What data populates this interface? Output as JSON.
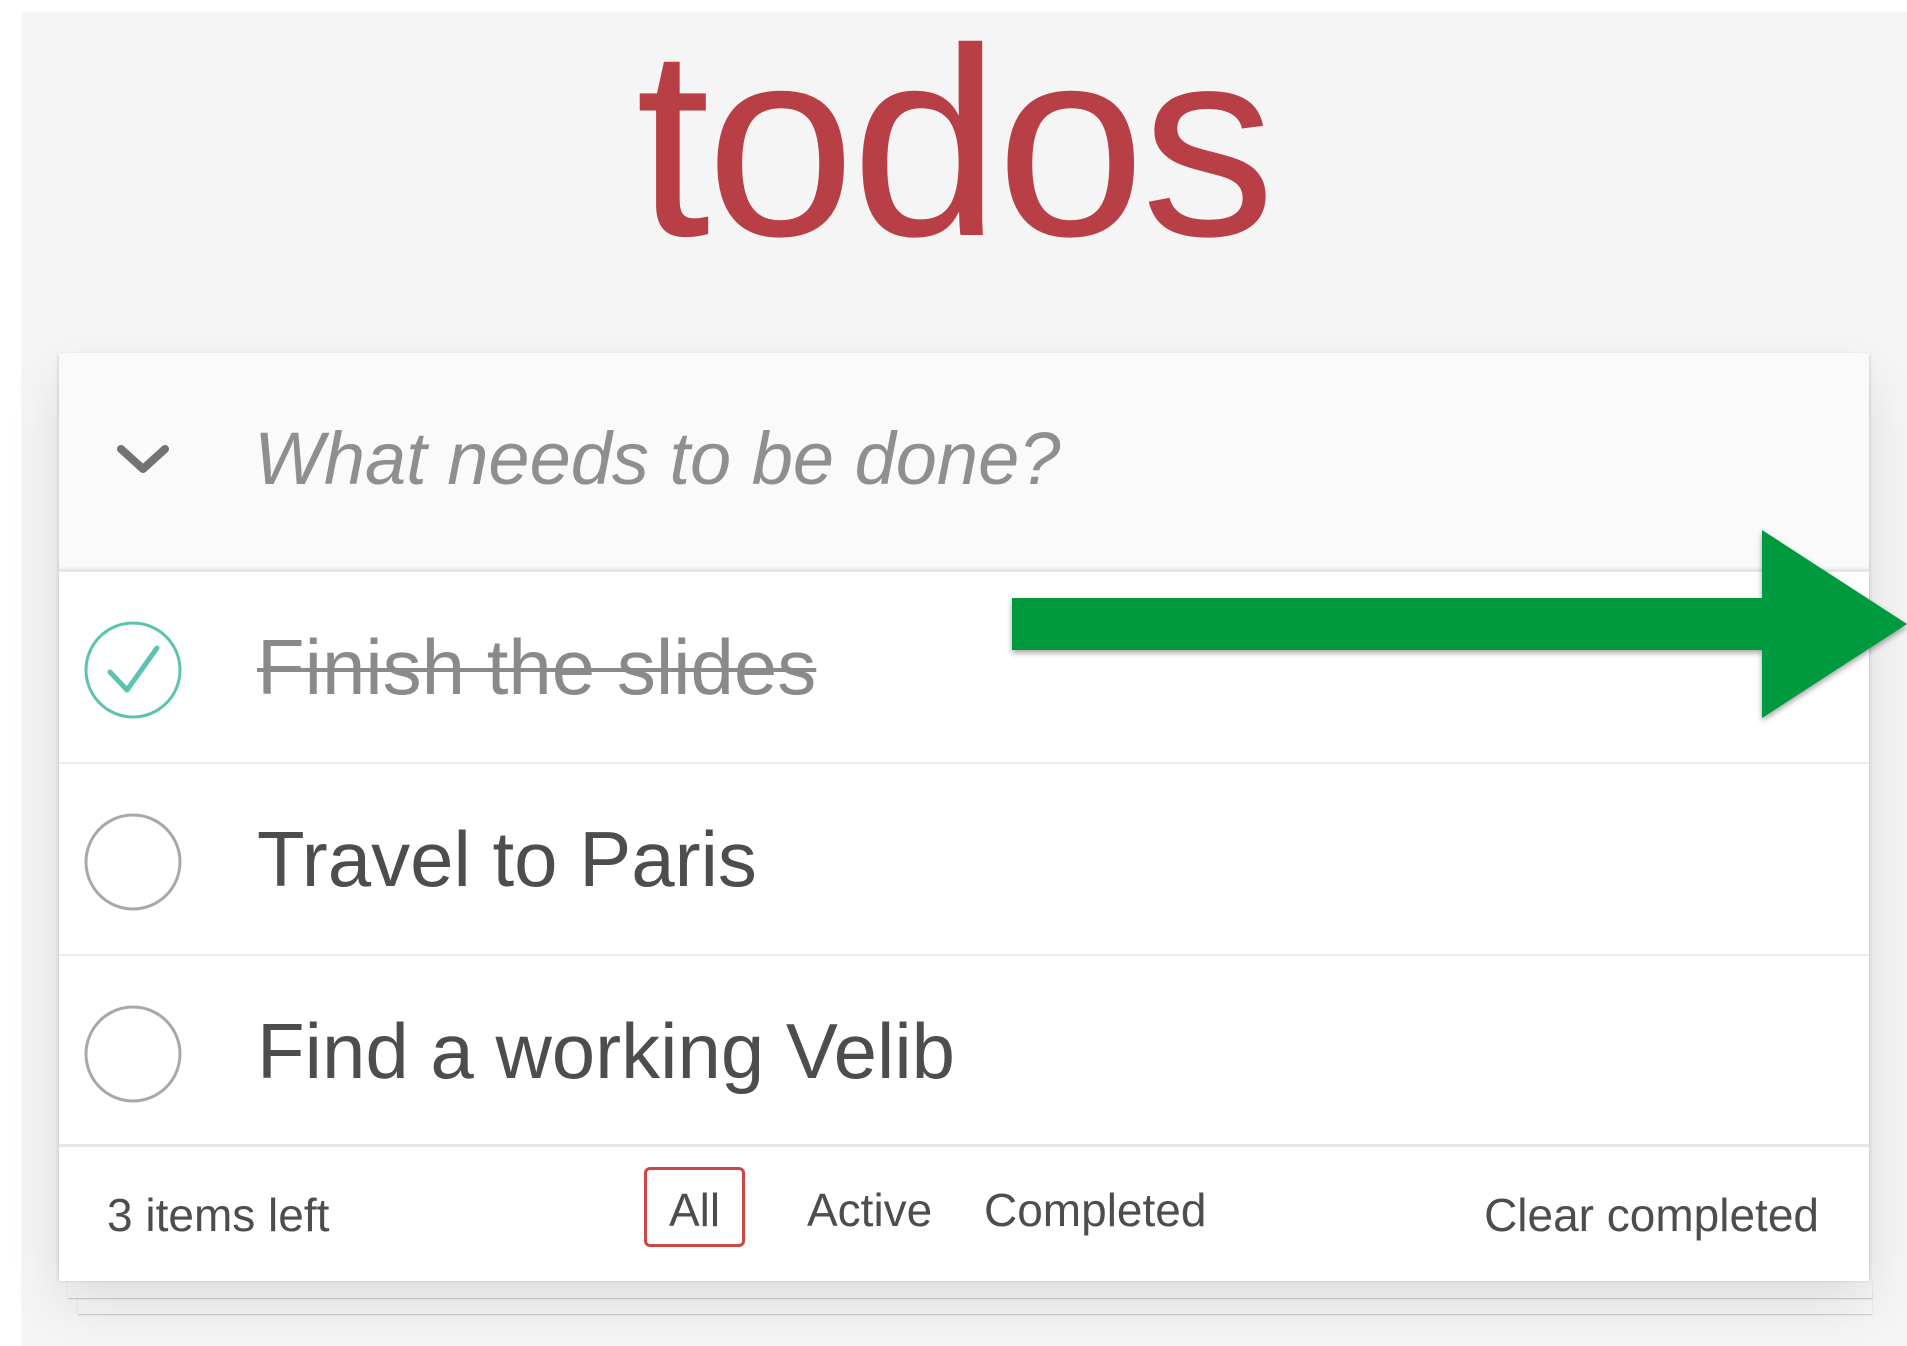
{
  "app": {
    "title": "todos"
  },
  "new_todo": {
    "placeholder": "What needs to be done?",
    "value": ""
  },
  "todos": [
    {
      "label": "Finish the slides",
      "completed": true
    },
    {
      "label": "Travel to Paris",
      "completed": false
    },
    {
      "label": "Find a working Velib",
      "completed": false
    }
  ],
  "footer": {
    "count_text": "3 items left",
    "filters": [
      {
        "label": "All",
        "selected": true
      },
      {
        "label": "Active",
        "selected": false
      },
      {
        "label": "Completed",
        "selected": false
      }
    ],
    "clear_completed": "Clear completed"
  },
  "colors": {
    "brand": "#b83f45",
    "check": "#5dc2af",
    "filter_selected_border": "#ce4646",
    "annotation_arrow": "#009a3e"
  },
  "icons": {
    "toggle_all": "chevron-down-icon",
    "complete": "check-circle-icon",
    "incomplete": "empty-circle-icon",
    "annotation": "right-arrow-icon"
  }
}
